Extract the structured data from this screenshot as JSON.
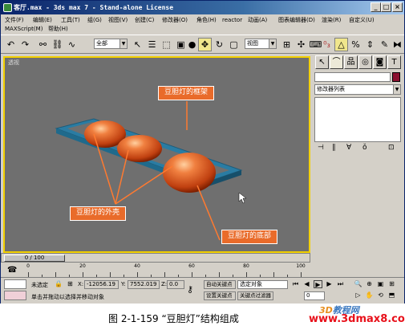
{
  "window": {
    "title": "客厅.max - 3ds max 7 - Stand-alone License",
    "min_label": "_",
    "max_label": "□",
    "close_label": "×"
  },
  "menu": {
    "items": [
      "文件(F)",
      "编辑(E)",
      "工具(T)",
      "组(G)",
      "视图(V)",
      "创建(C)",
      "修改器(O)",
      "角色(H)",
      "reactor",
      "动画(A)",
      "图表编辑器(D)",
      "渲染(R)",
      "自定义(U)"
    ],
    "row2": [
      "MAXScript(M)",
      "帮助(H)"
    ]
  },
  "toolbar": {
    "selection_filter": "全部",
    "coord_system": "视图",
    "icons": [
      "undo-icon",
      "redo-icon",
      "link-icon",
      "unlink-icon",
      "bind-spacewarp-icon",
      "select-icon",
      "select-by-name-icon",
      "rect-region-icon",
      "window-crossing-icon",
      "select-move-icon",
      "select-rotate-icon",
      "select-scale-icon",
      "pivot-icon",
      "select-manipulate-icon",
      "snap-icon",
      "angle-snap-icon",
      "percent-snap-icon",
      "spinner-snap-icon"
    ]
  },
  "viewport": {
    "label": "透视",
    "annotations": {
      "frame": "豆胆灯的框架",
      "shell": "豆胆灯的外壳",
      "base": "豆胆灯的底部"
    }
  },
  "command_panel": {
    "tab_icons": [
      "create-icon",
      "modify-icon",
      "hierarchy-icon",
      "motion-icon",
      "display-icon",
      "utilities-icon"
    ],
    "modifier_list": "修改器列表",
    "name_value": "",
    "swatch_color": "#8b1030"
  },
  "timeline": {
    "frame_label": "0 / 100",
    "ruler_labels": [
      "0",
      "20",
      "40",
      "60",
      "80",
      "100"
    ]
  },
  "status": {
    "selection_state": "未选定",
    "x_label": "X:",
    "x_value": "-12056.19",
    "y_label": "Y:",
    "y_value": "7552.019",
    "z_label": "Z:",
    "z_value": "0.0",
    "prompt": "单击并拖动以选择并移动对象",
    "auto_key": "自动关键点",
    "set_key": "设置关键点",
    "selected_object": "选定对象",
    "key_filters": "关键点过滤器",
    "frame_value": "0"
  },
  "caption": {
    "text": "图 2-1-159    “豆胆灯”结构组成"
  },
  "watermark": {
    "site_text": "www.3dmax8.com",
    "logo_a": "3D",
    "logo_b": "教程网"
  }
}
